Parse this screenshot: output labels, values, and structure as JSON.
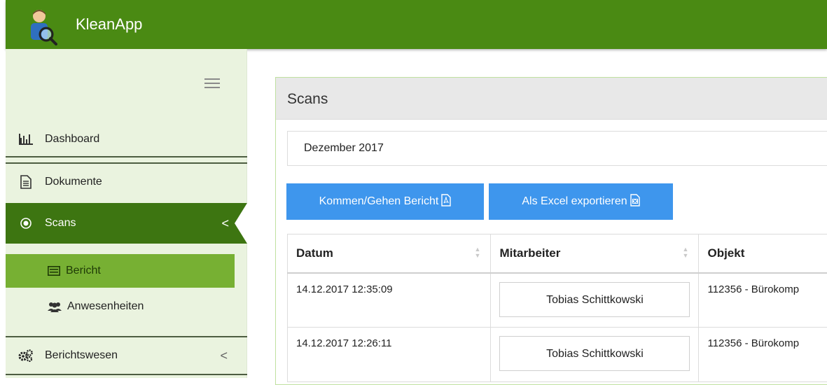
{
  "app": {
    "title": "KleanApp"
  },
  "sidebar": {
    "items": [
      {
        "label": "Dashboard",
        "icon": "bar-chart-icon"
      },
      {
        "label": "Dokumente",
        "icon": "document-icon"
      },
      {
        "label": "Scans",
        "icon": "circle-dot-icon",
        "active": true,
        "chevron": "<"
      },
      {
        "label": "Berichtswesen",
        "icon": "cogs-icon",
        "chevron": "<"
      }
    ],
    "subitems": [
      {
        "label": "Bericht",
        "icon": "report-icon",
        "active": true
      },
      {
        "label": "Anwesenheiten",
        "icon": "users-icon"
      }
    ]
  },
  "panel": {
    "title": "Scans",
    "month": "Dezember 2017",
    "buttons": {
      "kommen_gehen": "Kommen/Gehen Bericht",
      "excel": "Als Excel exportieren"
    }
  },
  "table": {
    "headers": [
      "Datum",
      "Mitarbeiter",
      "Objekt"
    ],
    "rows": [
      {
        "datum": "14.12.2017 12:35:09",
        "mitarbeiter": "Tobias Schittkowski",
        "objekt": "112356 - Bürokomp"
      },
      {
        "datum": "14.12.2017 12:26:11",
        "mitarbeiter": "Tobias Schittkowski",
        "objekt": "112356 - Bürokomp"
      }
    ]
  },
  "colors": {
    "topbar": "#4a8a13",
    "active_nav": "#3d7511",
    "active_sub": "#77b033",
    "button": "#3e96ed",
    "sidebar_bg": "#eaf3df"
  }
}
